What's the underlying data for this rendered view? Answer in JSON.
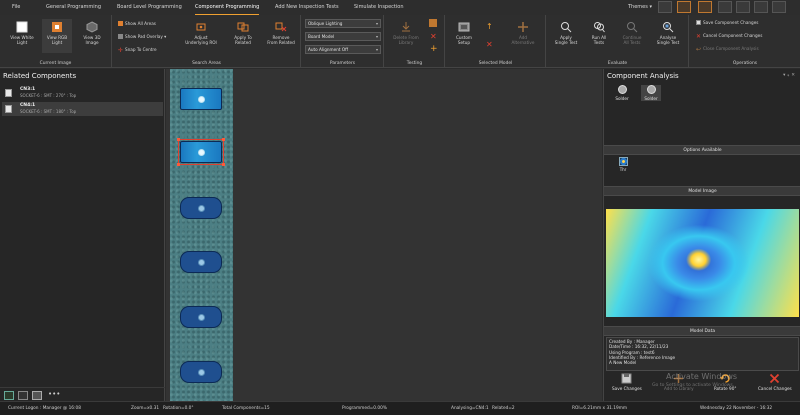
{
  "menu": {
    "tabs": [
      "File",
      "General Programming",
      "Board Level Programming",
      "Component Programming",
      "Add New Inspection Tests",
      "Simulate Inspection"
    ],
    "active_tab": "Component Programming",
    "themes_label": "Themes"
  },
  "ribbon": {
    "current_image": {
      "label": "Current Image",
      "view_white": "View White\nLight",
      "view_rgb": "View RGB\nLight",
      "view_3d": "View 3D\nImage"
    },
    "search_areas": {
      "label": "Search Areas",
      "show_all_areas": "Show All Areas",
      "show_pad_overlay": "Show Pad Overlay",
      "snap_to_centre": "Snap To Centre",
      "adjust_roi": "Adjust\nUnderlying ROI",
      "apply_to_related": "Apply To\nRelated",
      "remove_from_related": "Remove\nFrom Related"
    },
    "parameters": {
      "label": "Parameters",
      "lighting": "Oblique Lighting",
      "model": "Board Model",
      "alignment": "Auto Alignment Off"
    },
    "testing": {
      "label": "Testing",
      "delete_from_library": "Delete From\nLibrary"
    },
    "selected_model": {
      "label": "Selected Model",
      "custom_setup": "Custom\nSetup",
      "add_alternative": "Add\nAlternative"
    },
    "evaluate": {
      "label": "Evaluate",
      "apply_single_test": "Apply\nSingle Test",
      "run_all_tests": "Run All\nTests",
      "continue_all_tests": "Continue\nAll Tests",
      "analyse_single_test": "Analyse\nSingle Test"
    },
    "operations": {
      "label": "Operations",
      "save_changes": "Save Component Changes",
      "cancel_changes": "Cancel Component Changes",
      "close_analysis": "Close Component Analysis"
    }
  },
  "left_panel": {
    "title": "Related Components",
    "items": [
      {
        "name": "CN3:1",
        "desc": "SOCKET-6 : SMT : 270° : Top"
      },
      {
        "name": "CN4:1",
        "desc": "SOCKET-6 : SMT : 180° : Top"
      }
    ]
  },
  "right_panel": {
    "title": "Component Analysis",
    "algorithms": [
      "Solder",
      "Solder"
    ],
    "options_header": "Options Available",
    "option_thr": "Thr",
    "model_image_header": "Model Image",
    "model_data_header": "Model Data",
    "model_data": [
      "Created By : Manager",
      "Date/Time : 16:32, 22/11/23",
      "Using Program : test6",
      "Identified By : Reference Image",
      "A New Model"
    ],
    "buttons": {
      "save": "Save Changes",
      "add_library": "Add to Library",
      "rotate": "Rotate 90°",
      "cancel": "Cancel Changes"
    },
    "watermark": "Activate Windows",
    "watermark_sub": "Go to Settings to activate Windows."
  },
  "status": {
    "logon": "Current Logon : Manager @ 16:08",
    "zoom": "Zoom=x0.31",
    "rotation": "Rotation=0.0°",
    "total": "Total Components=15",
    "programmed": "Programmed=0.00%",
    "analysing": "Analysing=CN4:1",
    "related": "Related=2",
    "roi": "ROI=6.21mm x 31.19mm",
    "datetime": "Wednesday 22 November - 16:32"
  },
  "colors": {
    "accent": "#f0a030",
    "roi": "#e04030",
    "board": "#4c7f84"
  }
}
